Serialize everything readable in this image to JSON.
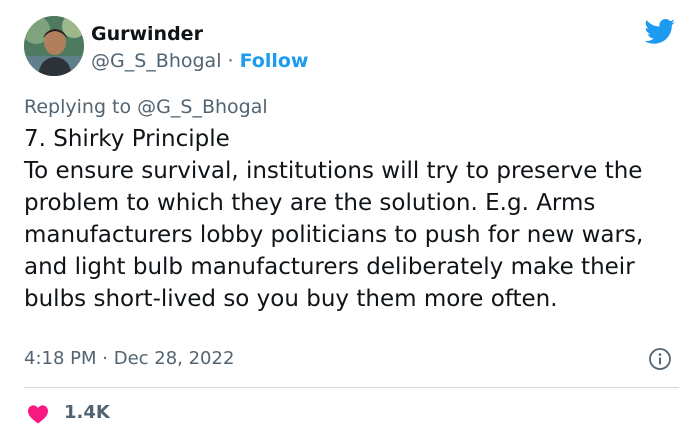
{
  "author": {
    "name": "Gurwinder",
    "handle": "@G_S_Bhogal",
    "separator": " · ",
    "follow_label": "Follow"
  },
  "reply": {
    "prefix": "Replying to ",
    "mention": "@G_S_Bhogal"
  },
  "tweet": {
    "lines": [
      "7. Shirky Principle",
      "To ensure survival, institutions will try to preserve the problem to which they are the solution. E.g. Arms manufacturers lobby politicians to push for new wars, and light bulb manufacturers deliberately make their bulbs short-lived so you buy them more often."
    ]
  },
  "meta": {
    "time": "4:18 PM",
    "separator": " · ",
    "date": "Dec 28, 2022"
  },
  "engagement": {
    "likes": "1.4K"
  },
  "colors": {
    "brand_blue": "#1d9bf0",
    "heart_pink": "#f91880",
    "muted_text": "#536471"
  },
  "icons": {
    "brand": "twitter-bird-icon",
    "info": "info-icon",
    "like": "heart-icon"
  }
}
